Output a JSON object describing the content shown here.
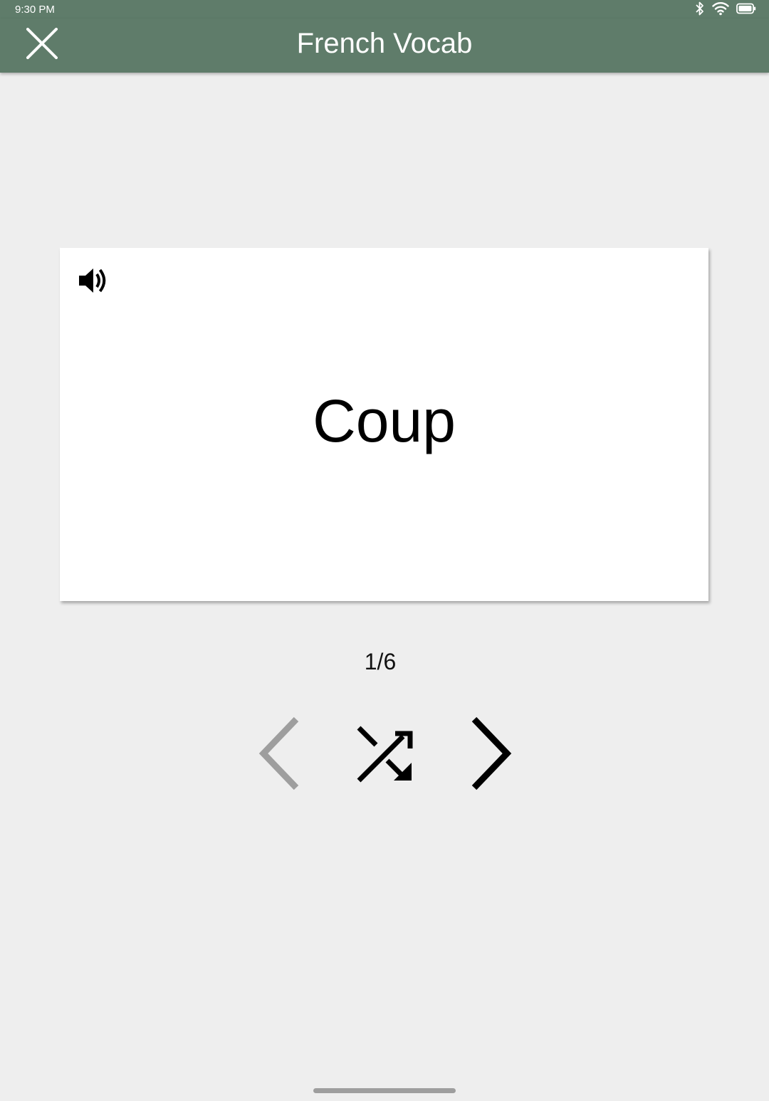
{
  "status_bar": {
    "time": "9:30 PM",
    "icons": [
      "bluetooth-icon",
      "wifi-icon",
      "battery-icon"
    ]
  },
  "app_bar": {
    "title": "French Vocab",
    "close_icon": "close-icon"
  },
  "card": {
    "term": "Coup",
    "audio_icon": "speaker-icon"
  },
  "progress": {
    "text": "1/6",
    "current": 1,
    "total": 6
  },
  "navigation": {
    "prev_icon": "chevron-left-icon",
    "prev_enabled": false,
    "shuffle_icon": "shuffle-icon",
    "next_icon": "chevron-right-icon",
    "next_enabled": true
  },
  "colors": {
    "app_bar": "#5f7c6a",
    "background": "#eeeeee",
    "card": "#ffffff",
    "disabled_icon": "#9e9e9e",
    "active_icon": "#000000"
  }
}
